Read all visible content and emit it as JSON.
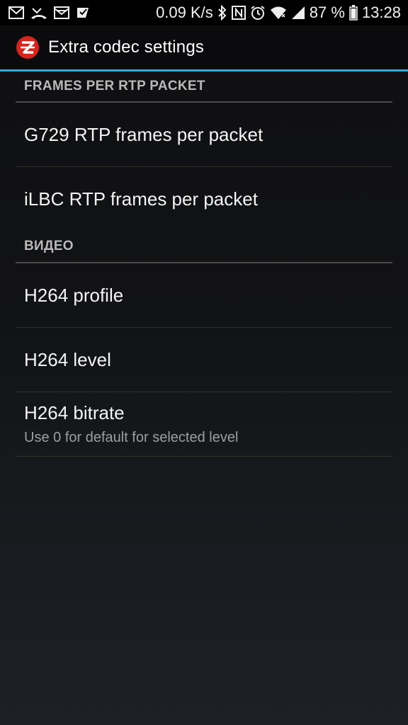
{
  "status_bar": {
    "speed": "0.09 K/s",
    "battery": "87 %",
    "time": "13:28",
    "left_icons": [
      "gmail-icon",
      "missed-call-icon",
      "mail-icon",
      "check-app-icon"
    ],
    "right_icons": [
      "bluetooth-icon",
      "nfc-icon",
      "alarm-icon",
      "wifi-icon",
      "signal-icon",
      "battery-icon"
    ]
  },
  "action_bar": {
    "title": "Extra codec settings",
    "logo_icon": "zoiper-logo-icon",
    "logo_color": "#d7241e"
  },
  "accent_color": "#35a9d6",
  "sections": [
    {
      "header": "FRAMES PER RTP PACKET",
      "items": [
        {
          "title": "G729 RTP frames per packet"
        },
        {
          "title": "iLBC RTP frames per packet"
        }
      ]
    },
    {
      "header": "ВИДЕО",
      "items": [
        {
          "title": "H264 profile"
        },
        {
          "title": "H264 level"
        },
        {
          "title": "H264 bitrate",
          "summary": "Use 0 for default for selected level"
        }
      ]
    }
  ]
}
